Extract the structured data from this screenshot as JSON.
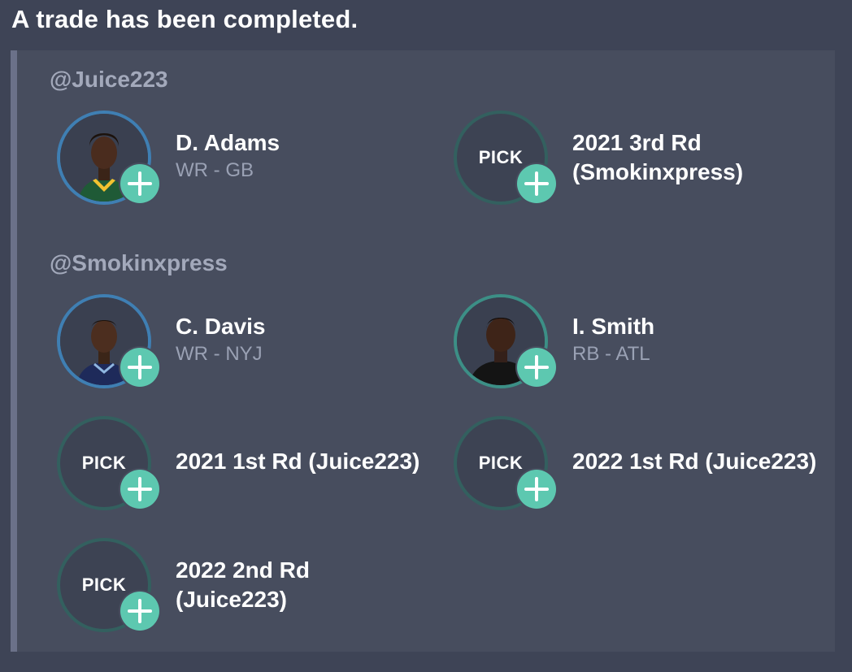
{
  "message": {
    "headline": "A trade has been completed."
  },
  "sections": [
    {
      "owner": "@Juice223",
      "items": [
        {
          "kind": "player",
          "name": "D. Adams",
          "detail": "WR - GB"
        },
        {
          "kind": "pick",
          "badge": "PICK",
          "line1": "2021 3rd Rd",
          "line2": "(Smokinxpress)"
        }
      ]
    },
    {
      "owner": "@Smokinxpress",
      "items": [
        {
          "kind": "player",
          "name": "C. Davis",
          "detail": "WR - NYJ"
        },
        {
          "kind": "player",
          "name": "I. Smith",
          "detail": "RB - ATL"
        },
        {
          "kind": "pick",
          "badge": "PICK",
          "line1": "2021 1st Rd (Juice223)"
        },
        {
          "kind": "pick",
          "badge": "PICK",
          "line1": "2022 1st Rd (Juice223)"
        },
        {
          "kind": "pick",
          "badge": "PICK",
          "line1": "2022 2nd Rd",
          "line2": "(Juice223)"
        }
      ]
    }
  ],
  "icons": {
    "add": "plus-icon",
    "avatar": "player-headshot-icon"
  },
  "colors": {
    "background": "#3e4456",
    "card": "#474d5e",
    "accent_bar": "#6b7189",
    "add_button": "#5dc8b0",
    "player_ring": "#3f7fb3",
    "pick_ring": "#33605f"
  }
}
